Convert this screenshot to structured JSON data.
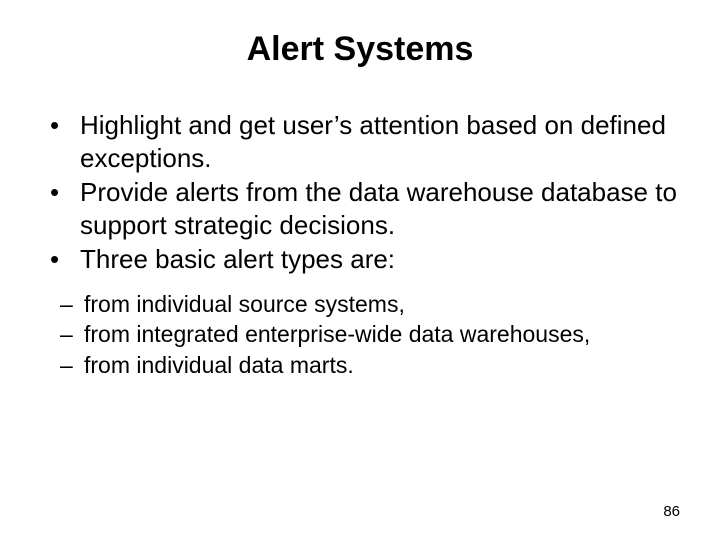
{
  "title": "Alert Systems",
  "bullets": [
    "Highlight and get user’s attention based on defined exceptions.",
    "Provide alerts from the data warehouse database to support strategic decisions.",
    "Three basic alert types are:"
  ],
  "sub_bullets": [
    "from individual source systems,",
    "from integrated enterprise-wide data warehouses,",
    "from individual data marts."
  ],
  "page_number": "86"
}
